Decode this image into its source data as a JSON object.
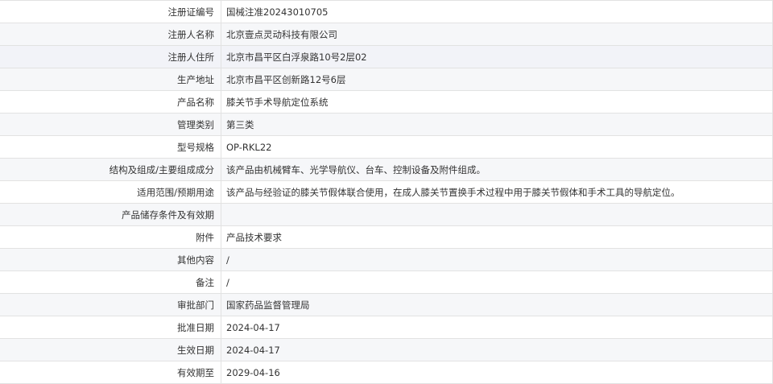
{
  "rows": [
    {
      "label": "注册证编号",
      "value": "国械注准20243010705"
    },
    {
      "label": "注册人名称",
      "value": "北京壹点灵动科技有限公司"
    },
    {
      "label": "注册人住所",
      "value": "北京市昌平区白浮泉路10号2层02"
    },
    {
      "label": "生产地址",
      "value": "北京市昌平区创新路12号6层"
    },
    {
      "label": "产品名称",
      "value": "膝关节手术导航定位系统"
    },
    {
      "label": "管理类别",
      "value": "第三类"
    },
    {
      "label": "型号规格",
      "value": "OP-RKL22"
    },
    {
      "label": "结构及组成/主要组成成分",
      "value": "该产品由机械臂车、光学导航仪、台车、控制设备及附件组成。"
    },
    {
      "label": "适用范围/预期用途",
      "value": "该产品与经验证的膝关节假体联合使用，在成人膝关节置换手术过程中用于膝关节假体和手术工具的导航定位。"
    },
    {
      "label": "产品储存条件及有效期",
      "value": ""
    },
    {
      "label": "附件",
      "value": "产品技术要求"
    },
    {
      "label": "其他内容",
      "value": "/"
    },
    {
      "label": "备注",
      "value": "/"
    },
    {
      "label": "审批部门",
      "value": "国家药品监督管理局"
    },
    {
      "label": "批准日期",
      "value": "2024-04-17"
    },
    {
      "label": "生效日期",
      "value": "2024-04-17"
    },
    {
      "label": "有效期至",
      "value": "2029-04-16"
    }
  ]
}
